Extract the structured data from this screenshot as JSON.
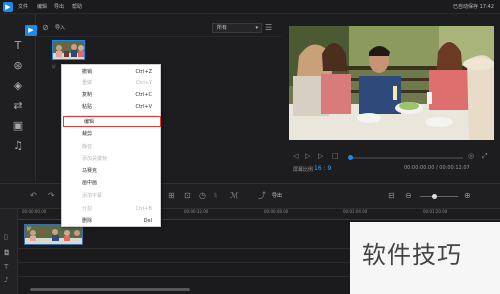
{
  "window": {
    "app_icon": "app-logo-icon",
    "menus": [
      "文件",
      "编辑",
      "导出",
      "帮助"
    ],
    "autosave_text": "已自动保存 17:42"
  },
  "sidebar": {
    "items": [
      {
        "icon": "media-icon",
        "glyph": "▶"
      },
      {
        "icon": "text-icon",
        "glyph": "T"
      },
      {
        "icon": "filters-icon",
        "glyph": "⊛"
      },
      {
        "icon": "overlay-icon",
        "glyph": "◈"
      },
      {
        "icon": "transitions-icon",
        "glyph": "⇄"
      },
      {
        "icon": "elements-icon",
        "glyph": "▣"
      },
      {
        "icon": "music-icon",
        "glyph": "♫"
      }
    ]
  },
  "media": {
    "import_label": "导入",
    "filter_value": "所有",
    "clip_name": "好"
  },
  "context_menu": {
    "items": [
      {
        "label": "撤销",
        "shortcut": "Ctrl+Z",
        "enabled": true
      },
      {
        "label": "重做",
        "shortcut": "Ctrl+Y",
        "enabled": false
      },
      {
        "label": "复制",
        "shortcut": "Ctrl+C",
        "enabled": true
      },
      {
        "label": "粘贴",
        "shortcut": "Ctrl+V",
        "enabled": true
      },
      {
        "label": "编辑",
        "shortcut": "",
        "enabled": true,
        "highlighted": true
      },
      {
        "label": "裁剪",
        "shortcut": "",
        "enabled": true
      },
      {
        "label": "静音",
        "shortcut": "",
        "enabled": false
      },
      {
        "label": "添加关键帧",
        "shortcut": "",
        "enabled": false
      },
      {
        "label": "马赛克",
        "shortcut": "",
        "enabled": true
      },
      {
        "label": "画中画",
        "shortcut": "",
        "enabled": true
      },
      {
        "label": "添加字幕",
        "shortcut": "",
        "enabled": false
      },
      {
        "label": "分割",
        "shortcut": "Ctrl+B",
        "enabled": false
      },
      {
        "label": "删除",
        "shortcut": "Del",
        "enabled": true
      }
    ]
  },
  "preview": {
    "aspect_label": "屏幕比例",
    "aspect_value": "16 : 9",
    "timecode": "00:00:00.00 / 00:00:12.07",
    "progress": 0
  },
  "toolbar": {
    "export_label": "导出",
    "zoom_level": 0.3
  },
  "timeline": {
    "ruler": [
      "00:00:00.00",
      "00:00:32.00",
      "00:00:48.00",
      "00:01:04.00",
      "00:01:20.00"
    ],
    "clip_label": "好"
  },
  "watermark": {
    "text": "软件技巧"
  }
}
